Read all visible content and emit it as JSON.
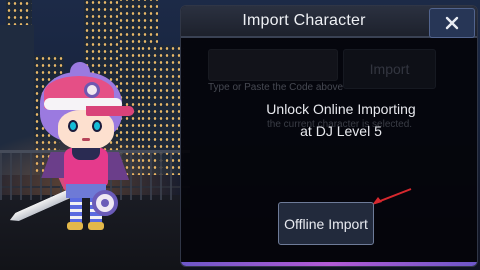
{
  "dialog": {
    "title": "Import Character",
    "close_label": "X",
    "code_input": {
      "placeholder": "",
      "value": ""
    },
    "import_label": "Import",
    "hint": "Type or Paste the Code above",
    "status": "the current character is selected.",
    "lock_message_line1": "Unlock Online Importing",
    "lock_message_line2": "at DJ Level 5",
    "offline_import_label": "Offline Import"
  },
  "icons": {
    "close": "close-icon",
    "arrow": "red-arrow-pointer"
  },
  "colors": {
    "dialog_bg": "#04040a",
    "header_bg": "#2b3140",
    "close_button_bg": "#273656",
    "offline_button_border": "#6e7b98",
    "arrow": "#d6282e",
    "accent": "#b35bd6"
  }
}
